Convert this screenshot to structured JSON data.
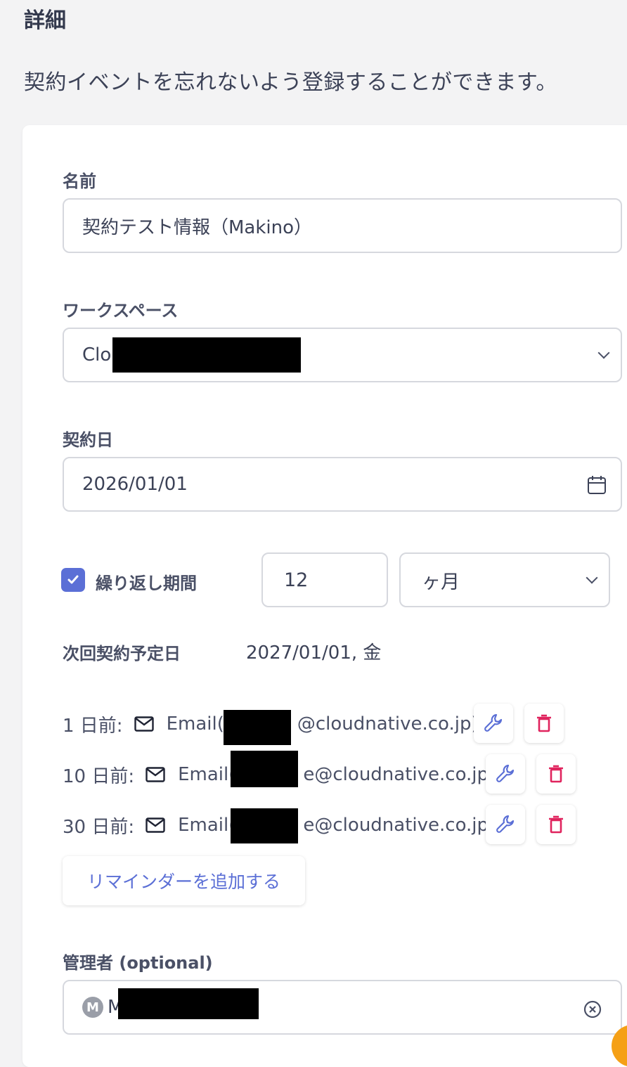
{
  "header": {
    "title": "詳細",
    "subtitle": "契約イベントを忘れないよう登録することができます。"
  },
  "form": {
    "name": {
      "label": "名前",
      "value": "契約テスト情報（Makino）"
    },
    "workspace": {
      "label": "ワークスペース",
      "value_visible": "Clou"
    },
    "contract_date": {
      "label": "契約日",
      "value": "2026/01/01"
    },
    "repeat": {
      "label": "繰り返し期間",
      "checked": true,
      "amount": "12",
      "unit": "ヶ月"
    },
    "next_date": {
      "label": "次回契約予定日",
      "value": "2027/01/01, 金"
    },
    "reminders": [
      {
        "day": "1 日前:",
        "email_prefix": "Email(",
        "email_suffix": "@cloudnative.co.jp)"
      },
      {
        "day": "10 日前:",
        "email_prefix": "Email(",
        "email_suffix": "e@cloudnative.co.jp)"
      },
      {
        "day": "30 日前:",
        "email_prefix": "Email(",
        "email_suffix": "e@cloudnative.co.jp)"
      }
    ],
    "add_reminder_label": "リマインダーを追加する",
    "manager": {
      "label": "管理者 (optional)",
      "avatar_letter": "M",
      "name_visible": "M"
    }
  },
  "colors": {
    "accent": "#5b6fd6",
    "danger": "#e0245e",
    "background": "#f3f3f4"
  },
  "icons": [
    "chevron-down-icon",
    "calendar-icon",
    "check-icon",
    "mail-icon",
    "wrench-icon",
    "trash-icon",
    "clear-icon"
  ]
}
